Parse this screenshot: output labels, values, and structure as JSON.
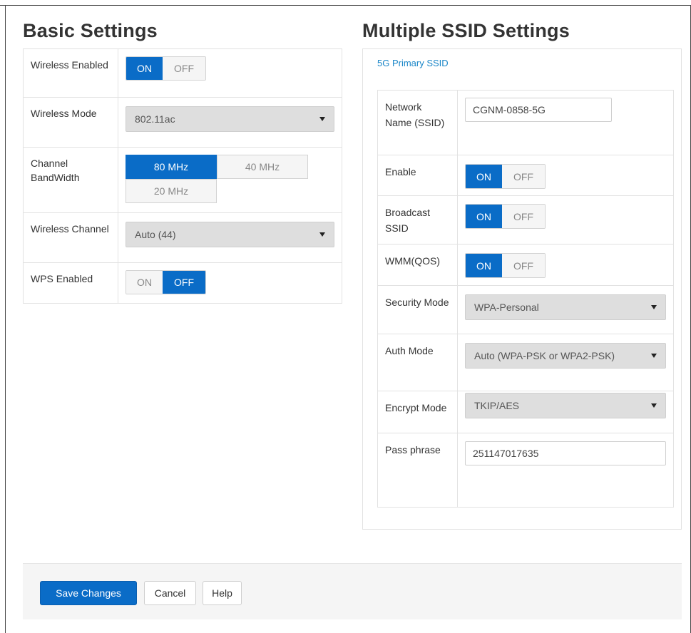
{
  "basic": {
    "title": "Basic Settings",
    "wireless_enabled": {
      "label": "Wireless Enabled",
      "on": "ON",
      "off": "OFF",
      "state": "ON"
    },
    "wireless_mode": {
      "label": "Wireless Mode",
      "value": "802.11ac"
    },
    "channel_bandwidth": {
      "label": "Channel BandWidth",
      "options": [
        "80 MHz",
        "40 MHz",
        "20 MHz"
      ],
      "selected": "80 MHz"
    },
    "wireless_channel": {
      "label": "Wireless Channel",
      "value": "Auto (44)"
    },
    "wps_enabled": {
      "label": "WPS Enabled",
      "on": "ON",
      "off": "OFF",
      "state": "OFF"
    }
  },
  "ssid": {
    "title": "Multiple SSID Settings",
    "tab": "5G Primary SSID",
    "network_name": {
      "label": "Network Name (SSID)",
      "value": "CGNM-0858-5G"
    },
    "enable": {
      "label": "Enable",
      "on": "ON",
      "off": "OFF",
      "state": "ON"
    },
    "broadcast_ssid": {
      "label": "Broadcast SSID",
      "on": "ON",
      "off": "OFF",
      "state": "ON"
    },
    "wmm": {
      "label": "WMM(QOS)",
      "on": "ON",
      "off": "OFF",
      "state": "ON"
    },
    "security_mode": {
      "label": "Security Mode",
      "value": "WPA-Personal"
    },
    "auth_mode": {
      "label": "Auth Mode",
      "value": "Auto (WPA-PSK or WPA2-PSK)"
    },
    "encrypt_mode": {
      "label": "Encrypt Mode",
      "value": "TKIP/AES"
    },
    "pass_phrase": {
      "label": "Pass phrase",
      "value": "251147017635"
    }
  },
  "footer": {
    "save": "Save Changes",
    "cancel": "Cancel",
    "help": "Help"
  },
  "colors": {
    "accent": "#0a6cc7",
    "link": "#1a86c8",
    "select_bg": "#dedede"
  }
}
